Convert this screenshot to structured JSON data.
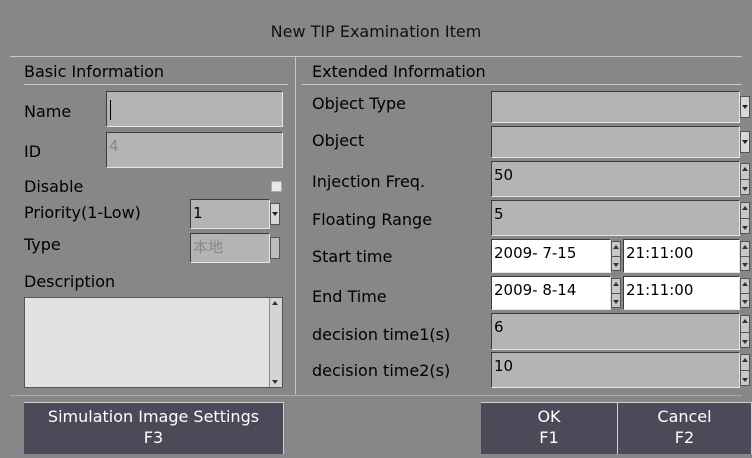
{
  "dialog": {
    "title": "New TIP Examination Item"
  },
  "basic": {
    "heading": "Basic Information",
    "name_label": "Name",
    "name_value": "",
    "id_label": "ID",
    "id_value": "4",
    "disable_label": "Disable",
    "disable_checked": false,
    "priority_label": "Priority(1-Low)",
    "priority_value": "1",
    "type_label": "Type",
    "type_value": "本地",
    "description_label": "Description",
    "description_value": ""
  },
  "extended": {
    "heading": "Extended Information",
    "object_type_label": "Object Type",
    "object_type_value": "",
    "object_label": "Object",
    "object_value": "",
    "injection_label": "Injection Freq.",
    "injection_value": "50",
    "floating_label": "Floating Range",
    "floating_value": "5",
    "start_label": "Start time",
    "start_date": "2009- 7-15",
    "start_time": "21:11:00",
    "end_label": "End Time",
    "end_date": "2009- 8-14",
    "end_time": "21:11:00",
    "decision1_label": "decision time1(s)",
    "decision1_value": "6",
    "decision2_label": "decision time2(s)",
    "decision2_value": "10"
  },
  "buttons": {
    "sim_label": "Simulation Image Settings",
    "sim_key": "F3",
    "ok_label": "OK",
    "ok_key": "F1",
    "cancel_label": "Cancel",
    "cancel_key": "F2"
  }
}
